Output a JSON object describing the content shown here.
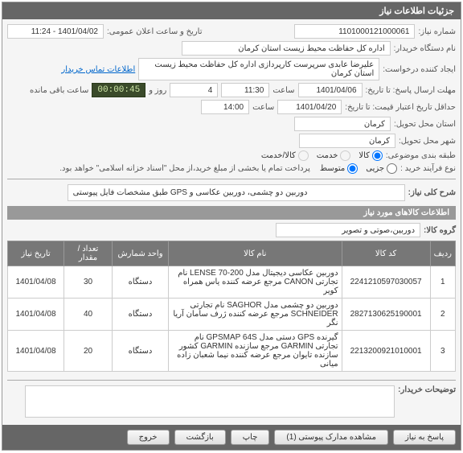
{
  "panel_title": "جزئیات اطلاعات نیاز",
  "labels": {
    "need_no": "شماره نیاز:",
    "buyer_org": "نام دستگاه خریدار:",
    "creator": "ایجاد کننده درخواست:",
    "deadline": "مهلت ارسال پاسخ: تا تاریخ:",
    "hour": "ساعت",
    "day_hour": "روز و",
    "remain": "ساعت باقی مانده",
    "valid_until": "حداقل تاریخ اعتبار قیمت: تا تاریخ:",
    "deliver_place": "استان محل تحویل:",
    "deliver_city": "شهر محل تحویل:",
    "category": "طبقه بندی موضوعی:",
    "process": "نوع فرآیند خرید :",
    "announce": "تاریخ و ساعت اعلان عمومی:",
    "contact": "اطلاعات تماس خریدار",
    "desc": "شرح کلی نیاز:",
    "goods_section": "اطلاعات کالاهای مورد نیاز",
    "goods_group": "گروه کالا:",
    "buyer_notes": "توضیحات خریدار:",
    "pay_note": "پرداخت تمام یا بخشی از مبلغ خرید،از محل \"اسناد خزانه اسلامی\" خواهد بود."
  },
  "values": {
    "need_no": "1101000121000061",
    "buyer_org": "اداره کل حفاظت محیط زیست استان کرمان",
    "creator": "علیرضا عابدی سرپرست کارپردازی اداره کل حفاظت محیط زیست استان کرمان",
    "deadline_date": "1401/04/06",
    "deadline_time": "11:30",
    "days_remain": "4",
    "countdown": "00:00:45",
    "valid_date": "1401/04/20",
    "valid_time": "14:00",
    "province": "کرمان",
    "city": "کرمان",
    "announce": "1401/04/02 - 11:24",
    "desc": "دوربین دو چشمی، دوربین عکاسی و GPS طبق مشخصات فایل پیوستی",
    "goods_group": "دوربین،صوتی و تصویر"
  },
  "category_opts": {
    "goods": "کالا",
    "service": "خدمت",
    "both": "کالا/خدمت"
  },
  "process_opts": {
    "minor": "جزیی",
    "medium": "متوسط"
  },
  "table": {
    "headers": {
      "row": "ردیف",
      "code": "کد کالا",
      "name": "نام کالا",
      "unit": "واحد شمارش",
      "qty": "تعداد / مقدار",
      "date": "تاریخ نیاز"
    },
    "rows": [
      {
        "n": "1",
        "code": "2241210597030057",
        "name": "دوربین عکاسی دیجیتال مدل LENSE 70-200 نام تجارتی CANON مرجع عرضه کننده یاس همراه کویر",
        "unit": "دستگاه",
        "qty": "30",
        "date": "1401/04/08"
      },
      {
        "n": "2",
        "code": "2827130625190001",
        "name": "دوربین دو چشمی مدل SAGHOR نام تجارتی SCHNEIDER مرجع عرضه کننده ژرف سامان آریا نگر",
        "unit": "دستگاه",
        "qty": "40",
        "date": "1401/04/08"
      },
      {
        "n": "3",
        "code": "2213200921010001",
        "name": "گیرنده GPS دستی مدل GPSMAP 64S نام تجارتی GARMIN مرجع سازنده GARMIN کشور سازنده تایوان مرجع عرضه کننده نیما شعبان زاده میانی",
        "unit": "دستگاه",
        "qty": "20",
        "date": "1401/04/08"
      }
    ]
  },
  "buttons": {
    "reply": "پاسخ به نیاز",
    "attach": "مشاهده مدارک پیوستی (1)",
    "print": "چاپ",
    "back": "بازگشت",
    "exit": "خروج"
  }
}
